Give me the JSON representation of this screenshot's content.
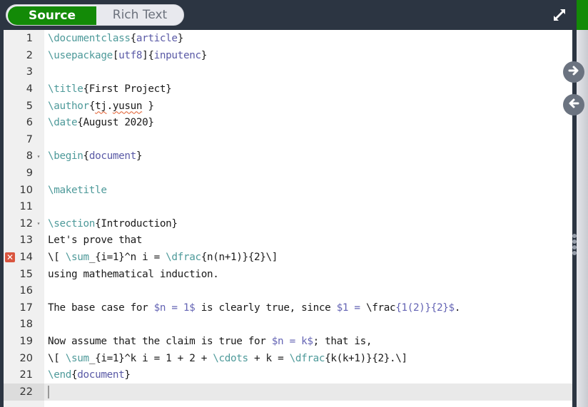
{
  "toolbar": {
    "source_label": "Source",
    "rich_text_label": "Rich Text",
    "active_mode": "Source",
    "expand_icon": "expand-arrows-icon"
  },
  "side_controls": {
    "forward_icon": "arrow-right-circle-icon",
    "back_icon": "arrow-left-circle-icon",
    "grip_icon": "drag-handle-icon"
  },
  "colors": {
    "accent_green": "#138a07",
    "command": "#4e9a9a",
    "argument": "#5a5aa6",
    "error": "#d9553f"
  },
  "editor": {
    "active_line": 22,
    "lines": [
      {
        "n": "1",
        "seg": [
          [
            "cmd",
            "\\documentclass"
          ],
          [
            "",
            "{"
          ],
          [
            "arg",
            "article"
          ],
          [
            "",
            "}"
          ]
        ]
      },
      {
        "n": "2",
        "seg": [
          [
            "cmd",
            "\\usepackage"
          ],
          [
            "",
            "["
          ],
          [
            "arg",
            "utf8"
          ],
          [
            "",
            "]{"
          ],
          [
            "arg",
            "inputenc"
          ],
          [
            "",
            "}"
          ]
        ]
      },
      {
        "n": "3",
        "seg": []
      },
      {
        "n": "4",
        "seg": [
          [
            "cmd",
            "\\title"
          ],
          [
            "",
            "{First Project}"
          ]
        ]
      },
      {
        "n": "5",
        "seg": [
          [
            "cmd",
            "\\author"
          ],
          [
            "",
            "{"
          ],
          [
            "squig",
            "tj"
          ],
          [
            "",
            "."
          ],
          [
            "squig",
            "yusun"
          ],
          [
            "",
            " }"
          ]
        ]
      },
      {
        "n": "6",
        "seg": [
          [
            "cmd",
            "\\date"
          ],
          [
            "",
            "{August 2020}"
          ]
        ]
      },
      {
        "n": "7",
        "seg": []
      },
      {
        "n": "8",
        "fold": true,
        "seg": [
          [
            "cmd",
            "\\begin"
          ],
          [
            "",
            "{"
          ],
          [
            "arg",
            "document"
          ],
          [
            "",
            "}"
          ]
        ]
      },
      {
        "n": "9",
        "seg": []
      },
      {
        "n": "10",
        "seg": [
          [
            "cmd",
            "\\maketitle"
          ]
        ]
      },
      {
        "n": "11",
        "seg": []
      },
      {
        "n": "12",
        "fold": true,
        "seg": [
          [
            "cmd",
            "\\section"
          ],
          [
            "",
            "{Introduction}"
          ]
        ]
      },
      {
        "n": "13",
        "seg": [
          [
            "",
            "Let's prove that"
          ]
        ]
      },
      {
        "n": "14",
        "error": true,
        "seg": [
          [
            "",
            "\\[ "
          ],
          [
            "cmd",
            "\\sum"
          ],
          [
            "",
            "_{i=1}^n i = "
          ],
          [
            "cmd",
            "\\dfrac"
          ],
          [
            "",
            "{n(n+1)}{2}\\]"
          ]
        ]
      },
      {
        "n": "15",
        "seg": [
          [
            "",
            "using mathematical induction."
          ]
        ]
      },
      {
        "n": "16",
        "seg": []
      },
      {
        "n": "17",
        "seg": [
          [
            "",
            "The base case for "
          ],
          [
            "math",
            "$n = 1$"
          ],
          [
            "",
            " is clearly true, since "
          ],
          [
            "math",
            "$1 = "
          ],
          [
            "",
            "\\frac"
          ],
          [
            "math",
            "{1(2)}{2}$"
          ],
          [
            "",
            "."
          ]
        ]
      },
      {
        "n": "18",
        "seg": []
      },
      {
        "n": "19",
        "seg": [
          [
            "",
            "Now assume that the claim is true for "
          ],
          [
            "math",
            "$n = k$"
          ],
          [
            "",
            "; that is,"
          ]
        ]
      },
      {
        "n": "20",
        "seg": [
          [
            "",
            "\\[ "
          ],
          [
            "cmd",
            "\\sum"
          ],
          [
            "",
            "_{i=1}^k i = 1 + 2 + "
          ],
          [
            "cmd",
            "\\cdots"
          ],
          [
            "",
            " + k = "
          ],
          [
            "cmd",
            "\\dfrac"
          ],
          [
            "",
            "{k(k+1)}{2}.\\]"
          ]
        ]
      },
      {
        "n": "21",
        "seg": [
          [
            "cmd",
            "\\end"
          ],
          [
            "",
            "{"
          ],
          [
            "arg",
            "document"
          ],
          [
            "",
            "}"
          ]
        ]
      },
      {
        "n": "22",
        "seg": []
      }
    ]
  }
}
